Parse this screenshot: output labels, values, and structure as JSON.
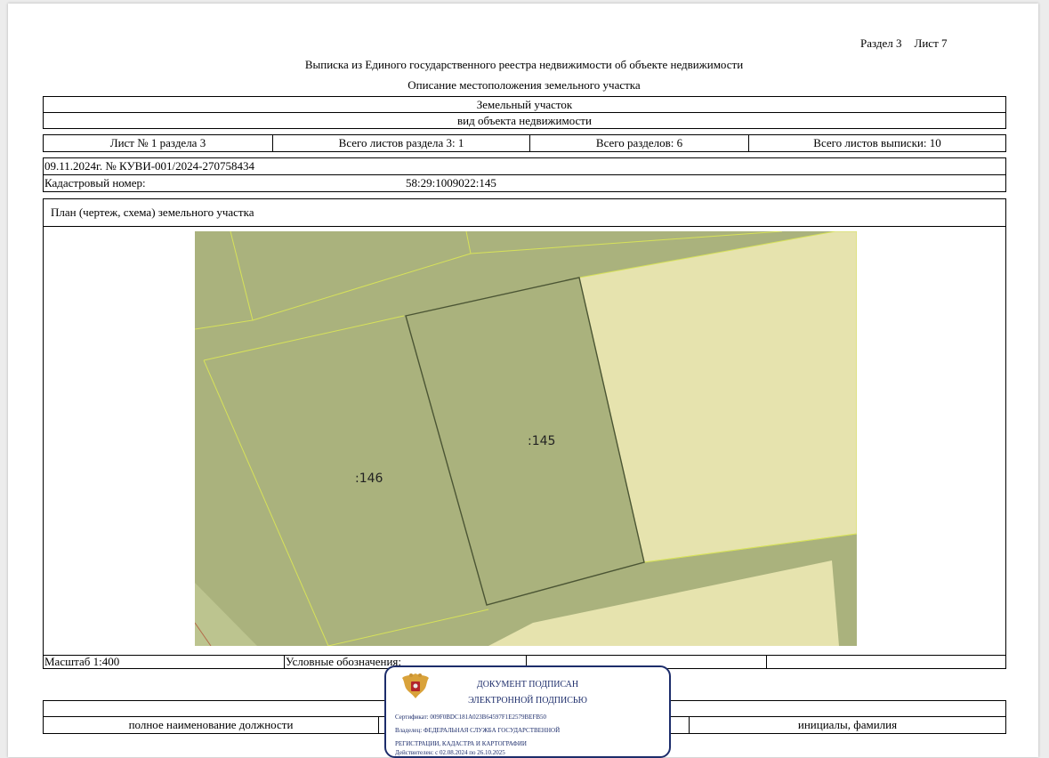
{
  "header": {
    "section": "Раздел 3",
    "sheet": "Лист 7",
    "title": "Выписка из Единого государственного реестра недвижимости об объекте недвижимости",
    "subtitle": "Описание местоположения земельного участка"
  },
  "object": {
    "type": "Земельный участок",
    "type_caption": "вид объекта недвижимости"
  },
  "sheets": {
    "sheet_no": "Лист № 1 раздела 3",
    "total_sheets_section": "Всего листов раздела 3: 1",
    "total_sections": "Всего разделов: 6",
    "total_sheets_extract": "Всего листов выписки: 10"
  },
  "record": {
    "date_number": "09.11.2024г. № КУВИ-001/2024-270758434",
    "cadastral_label": "Кадастровый номер:",
    "cadastral_number": "58:29:1009022:145"
  },
  "plan": {
    "title": "План (чертеж, схема) земельного участка",
    "parcels": [
      ":146",
      ":145"
    ],
    "colors": {
      "parcel": "#aab27d",
      "road": "#a3ab76",
      "light": "#e6e3ae",
      "border_yellow": "#d7e25a",
      "border_dark": "#4b5534"
    }
  },
  "legend": {
    "scale": "Масштаб 1:400",
    "legend_label": "Условные обозначения:"
  },
  "signature": {
    "position_caption": "полное наименование должности",
    "name_caption": "инициалы, фамилия"
  },
  "stamp": {
    "line1": "ДОКУМЕНТ ПОДПИСАН",
    "line2": "ЭЛЕКТРОННОЙ ПОДПИСЬЮ",
    "certificate": "Сертификат: 009F0BDC181A023B64597F1E2579BEFB50",
    "owner_line1": "Владелец: ФЕДЕРАЛЬНАЯ СЛУЖБА ГОСУДАРСТВЕННОЙ",
    "owner_line2": "РЕГИСТРАЦИИ, КАДАСТРА И КАРТОГРАФИИ",
    "valid": "Действителен: с 02.08.2024 по 26.10.2025",
    "color": "#1d2d6b"
  }
}
